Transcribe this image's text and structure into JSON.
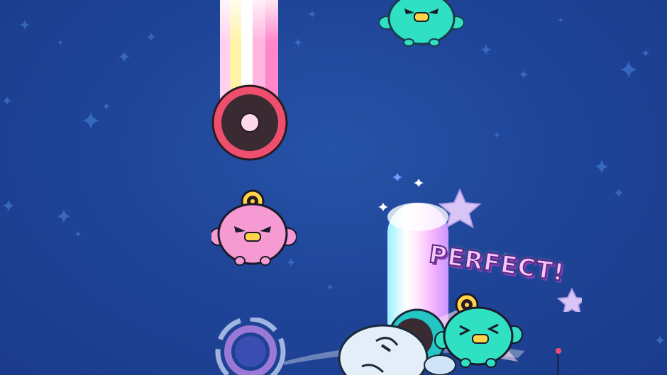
{
  "hud": {
    "judgement": "PERFECT!"
  },
  "colors": {
    "background": "#1f4599",
    "pink_bird": "#f59ad2",
    "teal_bird": "#2fe0c3",
    "note_ring": "#ef4f6f",
    "note_core": "#3a2a32"
  },
  "sprites": [
    "falling-rainbow-beam",
    "note-target-ring",
    "pink-bird-enemy",
    "teal-bird-enemy",
    "hit-rainbow-beam",
    "player-character",
    "lane-target-ring"
  ]
}
